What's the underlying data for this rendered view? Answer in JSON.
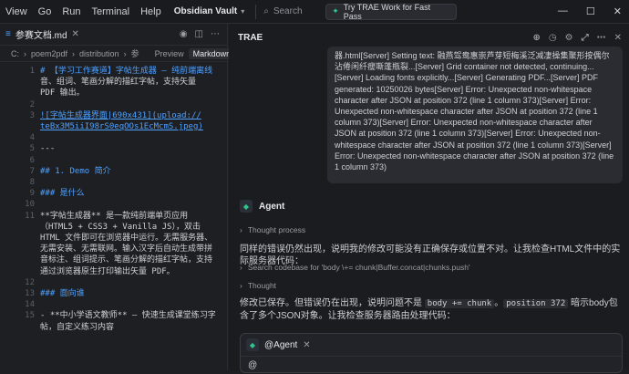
{
  "menu": [
    "View",
    "Go",
    "Run",
    "Terminal",
    "Help"
  ],
  "vault": "Obsidian Vault",
  "search": "Search",
  "try": "Try TRAE Work for Fast Pass",
  "tab": {
    "title": "参赛文档.md"
  },
  "breadcrumb": {
    "c": "C:",
    "p1": "poem2pdf",
    "p2": "distribution",
    "p3": "参",
    "preview": "Preview",
    "markdown": "Markdown"
  },
  "editor": {
    "l1a": "# 【学习工作赛道】字帖生成器 — 纯前端离线",
    "l1b": "音、组词、笔画分解的描红字帖，支持矢量",
    "l1c": "PDF 输出。",
    "l5a": "![字帖生成器界面|690x431](upload://",
    "l5b": "teBx3M5iiI98rS0eqOOs1EcMcmS.jpeg)",
    "l7": "---",
    "l9": "## 1. Demo 简介",
    "l11": "### 是什么",
    "l13a": "**字帖生成器** 是一款纯前端单页应用",
    "l13b": "（HTML5 + CSS3 + Vanilla JS），双击",
    "l13c": "HTML 文件即可在浏览器中运行。无需服务器、",
    "l13d": "无需安装、无需联网。输入汉字后自动生成带拼",
    "l13e": "音标注、组词提示、笔画分解的描红字帖，支持",
    "l13f": "通过浏览器原生打印输出矢量 PDF。",
    "l15": "### 面向谁",
    "l17a": "- **中小学语文教师** — 快速生成课堂练习字",
    "l17b": "帖，自定义练习内容"
  },
  "chat": {
    "title": "TRAE",
    "log": "器.html[Server] Setting text: 融燕驾鸯惠崇芦芽短梅溪泛减凄操集聚形按偶尔沾倦闲纤瘦嘶蓬瓶裂...[Server] Grid container not detected, continuing...[Server] Loading fonts explicitly...[Server] Generating PDF...[Server] PDF generated: 10250026 bytes[Server] Error: Unexpected non-whitespace character after JSON at position 372 (line 1 column 373)[Server] Error: Unexpected non-whitespace character after JSON at position 372 (line 1 column 373)[Server] Error: Unexpected non-whitespace character after JSON at position 372 (line 1 column 373)[Server] Error: Unexpected non-whitespace character after JSON at position 372 (line 1 column 373)[Server] Error: Unexpected non-whitespace character after JSON at position 372 (line 1 column 373)",
    "agent": "Agent",
    "thought1": "Thought process",
    "para1": "同样的错误仍然出现，说明我的修改可能没有正确保存或位置不对。让我检查HTML文件中的实际服务器代码：",
    "search_codebase": "Search codebase for 'body \\+= chunk|Buffer.concat|chunks.push'",
    "thought2": "Thought",
    "para2a": "修改已保存。但错误仍在出现，说明问题不是 ",
    "code1": "body += chunk",
    "para2b": "。",
    "code2": "position 372",
    "para2c": " 暗示body包含了多个JSON对象。让我检查服务器路由处理代码：",
    "input_agent": "@Agent",
    "input_at": "@"
  }
}
